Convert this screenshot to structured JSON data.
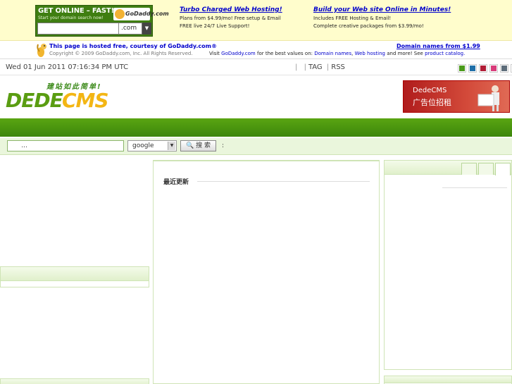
{
  "godaddy": {
    "headline": "GET ONLINE – FAST!",
    "subline": "Start your domain search now!",
    "logo_text": "GoDaddy.com",
    "tld": ".com",
    "promo1": {
      "title": "Turbo Charged Web Hosting!",
      "line1": "Plans from $4.99/mo! Free setup & Email",
      "line2": "FREE live 24/7 Live Support!"
    },
    "promo2": {
      "title": "Build your Web site Online in Minutes!",
      "line1": "Includes FREE Hosting & Email!",
      "line2": "Complete creative packages from $3.99/mo!"
    },
    "hosted_prefix": "This page is hosted free, courtesy of",
    "hosted_link": "GoDaddy.com",
    "hosted_suffix": "®",
    "copyright": "Copyright © 2009 GoDaddy.com, Inc. All Rights Reserved.",
    "visit_prefix": "Visit",
    "visit_link": "GoDaddy.com",
    "visit_mid": "for the best values on:",
    "domain_names": "Domain names",
    "web_hosting": "Web hosting",
    "visit_more": "and more! See",
    "product_catalog": "product catalog.",
    "domain_price": "Domain names from $1.99"
  },
  "datebar": {
    "date": "Wed 01 Jun 2011 07:16:34 PM UTC",
    "date_suffix": "   ",
    "links": [
      "    ",
      "    ",
      "TAG  ",
      "RSS  "
    ],
    "sep": "|",
    "skin_label": "     ",
    "skin_colors": [
      "#4a9a1a",
      "#1f6fa8",
      "#b01c35",
      "#d83c7a",
      "#5d6d7a",
      "#7a5a3a"
    ]
  },
  "logo": {
    "slogan": "建站如此简单!",
    "dede": "DEDE",
    "cms": "CMS"
  },
  "ad": {
    "line1": "DedeCMS",
    "line2": "广告位招租"
  },
  "nav": {
    "home": "  "
  },
  "search": {
    "placeholder": "     ...",
    "select": "google  ",
    "button": "搜 索",
    "hot_label": "    :"
  },
  "left_panel": {
    "title": "    "
  },
  "center_panel": {
    "title": "最近更新"
  },
  "right_panel": {
    "title": "    ",
    "tabs": [
      "  ",
      "  ",
      "  "
    ],
    "row": "      "
  },
  "bottom_left": {
    "title": "    "
  },
  "bottom_right": {
    "title": "    "
  }
}
